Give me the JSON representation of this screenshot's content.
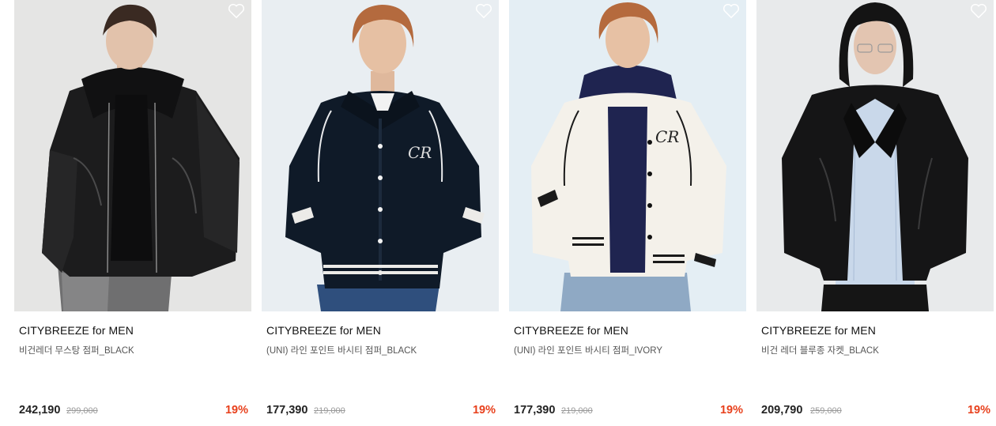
{
  "colors": {
    "discount": "#e8401c",
    "sale_price": "#222222",
    "original_price": "#999999"
  },
  "wishlist_icon": "heart-outline-icon",
  "products": [
    {
      "brand": "CITYBREEZE for MEN",
      "name": "비건레더 무스탕 점퍼_BLACK",
      "sale_price": "242,190",
      "original_price": "299,000",
      "discount": "19%",
      "image": "black-leather-shearling-jacket"
    },
    {
      "brand": "CITYBREEZE for MEN",
      "name": "(UNI) 라인 포인트 바시티 점퍼_BLACK",
      "sale_price": "177,390",
      "original_price": "219,000",
      "discount": "19%",
      "image": "black-varsity-jacket"
    },
    {
      "brand": "CITYBREEZE for MEN",
      "name": "(UNI) 라인 포인트 바시티 점퍼_IVORY",
      "sale_price": "177,390",
      "original_price": "219,000",
      "discount": "19%",
      "image": "ivory-varsity-jacket"
    },
    {
      "brand": "CITYBREEZE for MEN",
      "name": "비건 레더 블루종 자켓_BLACK",
      "sale_price": "209,790",
      "original_price": "259,000",
      "discount": "19%",
      "image": "black-leather-blouson-jacket"
    }
  ]
}
